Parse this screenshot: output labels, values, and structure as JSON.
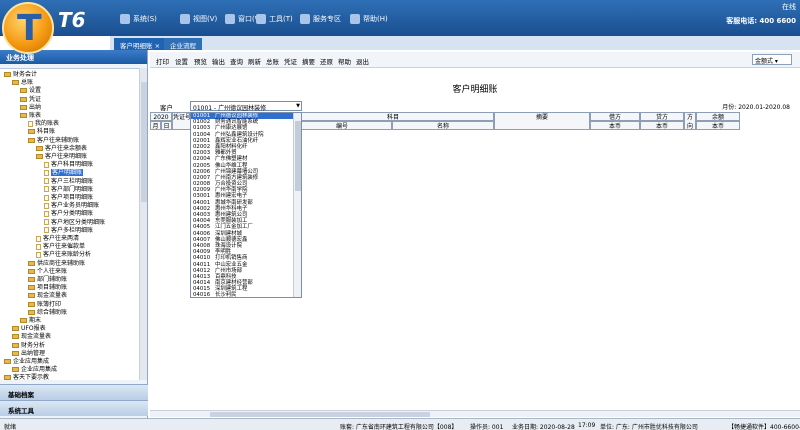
{
  "app": {
    "logo_text": "T6",
    "online_text": "在线",
    "hotline": "客服电话: 400 6600"
  },
  "menu": [
    {
      "label": "系统(S)",
      "icon": "system-icon"
    },
    {
      "label": "视图(V)",
      "icon": "view-icon"
    },
    {
      "label": "窗口(W)",
      "icon": "window-icon"
    },
    {
      "label": "工具(T)",
      "icon": "gear-icon"
    },
    {
      "label": "服务专区",
      "icon": "service-icon"
    },
    {
      "label": "帮助(H)",
      "icon": "help-icon"
    }
  ],
  "tabs": [
    {
      "label": "客户明细账",
      "active": true
    },
    {
      "label": "企业流程",
      "active": false
    }
  ],
  "left": {
    "header": "业务处理",
    "tree": [
      {
        "label": "财务会计",
        "level": 0,
        "type": "folder"
      },
      {
        "label": "总账",
        "level": 1,
        "type": "folder"
      },
      {
        "label": "设置",
        "level": 2,
        "type": "folder"
      },
      {
        "label": "凭证",
        "level": 2,
        "type": "folder"
      },
      {
        "label": "出纳",
        "level": 2,
        "type": "folder"
      },
      {
        "label": "账表",
        "level": 2,
        "type": "folder"
      },
      {
        "label": "我的账表",
        "level": 3,
        "type": "doc"
      },
      {
        "label": "科目账",
        "level": 3,
        "type": "folder"
      },
      {
        "label": "客户往来辅助账",
        "level": 3,
        "type": "folder"
      },
      {
        "label": "客户往来余额表",
        "level": 4,
        "type": "folder"
      },
      {
        "label": "客户往来明细账",
        "level": 4,
        "type": "folder"
      },
      {
        "label": "客户科目明细账",
        "level": 5,
        "type": "doc"
      },
      {
        "label": "客户明细账",
        "level": 5,
        "type": "doc",
        "selected": true
      },
      {
        "label": "客户三栏明细账",
        "level": 5,
        "type": "doc"
      },
      {
        "label": "客户部门明细账",
        "level": 5,
        "type": "doc"
      },
      {
        "label": "客户项目明细账",
        "level": 5,
        "type": "doc"
      },
      {
        "label": "客户业务员明细账",
        "level": 5,
        "type": "doc"
      },
      {
        "label": "客户分类明细账",
        "level": 5,
        "type": "doc"
      },
      {
        "label": "客户地区分类明细账",
        "level": 5,
        "type": "doc"
      },
      {
        "label": "客户多栏明细账",
        "level": 5,
        "type": "doc"
      },
      {
        "label": "客户往来两清",
        "level": 4,
        "type": "doc"
      },
      {
        "label": "客户往来催款单",
        "level": 4,
        "type": "doc"
      },
      {
        "label": "客户往来账龄分析",
        "level": 4,
        "type": "doc"
      },
      {
        "label": "供应商往来辅助账",
        "level": 3,
        "type": "folder"
      },
      {
        "label": "个人往来账",
        "level": 3,
        "type": "folder"
      },
      {
        "label": "部门辅助账",
        "level": 3,
        "type": "folder"
      },
      {
        "label": "项目辅助账",
        "level": 3,
        "type": "folder"
      },
      {
        "label": "现金流量表",
        "level": 3,
        "type": "folder"
      },
      {
        "label": "账簿打印",
        "level": 3,
        "type": "folder"
      },
      {
        "label": "综合辅助账",
        "level": 3,
        "type": "folder"
      },
      {
        "label": "期末",
        "level": 2,
        "type": "folder"
      },
      {
        "label": "UFO报表",
        "level": 1,
        "type": "folder"
      },
      {
        "label": "现金流量表",
        "level": 1,
        "type": "folder"
      },
      {
        "label": "财务分析",
        "level": 1,
        "type": "folder"
      },
      {
        "label": "出纳管理",
        "level": 1,
        "type": "folder"
      },
      {
        "label": "企业应用集成",
        "level": 0,
        "type": "folder"
      },
      {
        "label": "企业应用集成",
        "level": 1,
        "type": "folder"
      },
      {
        "label": "客天下要示教",
        "level": 0,
        "type": "folder"
      }
    ],
    "bottom_buttons": [
      "基础档案",
      "系统工具"
    ]
  },
  "toolbar": {
    "buttons": [
      "打印",
      "设置",
      "预览",
      "输出",
      "查询",
      "刷新",
      "总账",
      "凭证",
      "摘要",
      "还原",
      "帮助",
      "退出"
    ],
    "style_value": "金额式"
  },
  "report": {
    "title": "客户明细账",
    "customer_label": "客户",
    "customer_value": "01001 - 广州德议园林装修",
    "month_range": "月份: 2020.01-2020.08",
    "headers": {
      "year": "2020年",
      "month": "月",
      "day": "日",
      "voucher_no": "凭证号",
      "subject": "科目",
      "name": "名称",
      "code": "编号",
      "desc": "摘要",
      "debit": "借方",
      "credit": "贷方",
      "direction": "方向",
      "balance": "余额",
      "currency1": "本币",
      "currency2": "本币",
      "currency3": "本币"
    }
  },
  "dropdown": [
    {
      "code": "01001",
      "name": "广州德议园林装修"
    },
    {
      "code": "01002",
      "name": "财务通讯智能系统"
    },
    {
      "code": "01003",
      "name": "广州康达展馆"
    },
    {
      "code": "01004",
      "name": "广州弘鑫建筑设计院"
    },
    {
      "code": "02001",
      "name": "鑫辉宏业石油化纤"
    },
    {
      "code": "02002",
      "name": "鑫阳材料化纤"
    },
    {
      "code": "02003",
      "name": "雅都外贸"
    },
    {
      "code": "02004",
      "name": "广东佛塑建材"
    },
    {
      "code": "02005",
      "name": "佛山华维工程"
    },
    {
      "code": "02006",
      "name": "广州锦建幕墙公司"
    },
    {
      "code": "02007",
      "name": "广州南方建筑装修"
    },
    {
      "code": "02008",
      "name": "万合投资公司"
    },
    {
      "code": "02009",
      "name": "广州华南学院"
    },
    {
      "code": "03001",
      "name": "惠州建宏电子"
    },
    {
      "code": "04001",
      "name": "惠城华南研发部"
    },
    {
      "code": "04002",
      "name": "惠州华科电子"
    },
    {
      "code": "04003",
      "name": "惠州建筑公司"
    },
    {
      "code": "04004",
      "name": "东莞服装加工"
    },
    {
      "code": "04005",
      "name": "江门五金加工厂"
    },
    {
      "code": "04006",
      "name": "深圳建材城"
    },
    {
      "code": "04007",
      "name": "佛山顺德宏鑫"
    },
    {
      "code": "04008",
      "name": "珠海设计院"
    },
    {
      "code": "04009",
      "name": "李明胜"
    },
    {
      "code": "04010",
      "name": "打印机销售商"
    },
    {
      "code": "04011",
      "name": "中山宏业五金"
    },
    {
      "code": "04012",
      "name": "广州市场部"
    },
    {
      "code": "04013",
      "name": "百鼎科技"
    },
    {
      "code": "04014",
      "name": "南京建材经营部"
    },
    {
      "code": "04015",
      "name": "深圳建筑工程"
    },
    {
      "code": "04016",
      "name": "长沙利民"
    },
    {
      "code": "04017",
      "name": "湘潭建材总厂"
    },
    {
      "code": "04018",
      "name": "上海化工"
    },
    {
      "code": "04019",
      "name": "东莞企业"
    },
    {
      "code": "04020",
      "name": "英德建材厂"
    }
  ],
  "status": {
    "ready": "就绪",
    "account": "账套: 广东省南环建筑工程有限公司【008】",
    "operator": "操作员: 001",
    "business_date": "业务日期: 2020-08-28",
    "time": "17:09",
    "unit": "单位: 广东: 广州市胜优科技有限公司",
    "hotline": "【畅捷通软件】400-6600-5"
  },
  "colors": {
    "header_blue": "#1a4f8f",
    "selection_blue": "#2f6fd0",
    "logo_orange": "#f59a12"
  }
}
